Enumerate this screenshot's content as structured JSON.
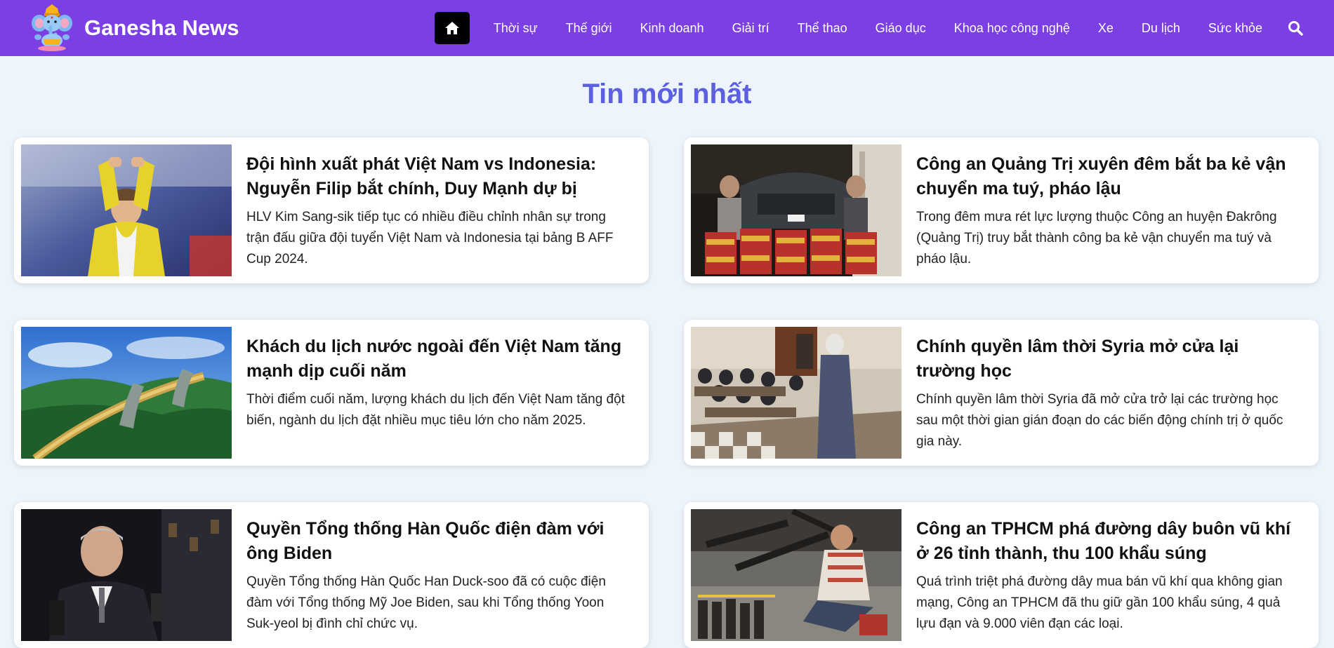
{
  "brand": {
    "name": "Ganesha News"
  },
  "nav": {
    "items": [
      "Thời sự",
      "Thế giới",
      "Kinh doanh",
      "Giải trí",
      "Thể thao",
      "Giáo dục",
      "Khoa học công nghệ",
      "Xe",
      "Du lịch",
      "Sức khỏe"
    ]
  },
  "section": {
    "title": "Tin mới nhất"
  },
  "articles": [
    {
      "title": "Đội hình xuất phát Việt Nam vs Indonesia: Nguyễn Filip bắt chính, Duy Mạnh dự bị",
      "description": "HLV Kim Sang-sik tiếp tục có nhiều điều chỉnh nhân sự trong trận đấu giữa đội tuyển Việt Nam và Indonesia tại bảng B AFF Cup 2024.",
      "image": "goalkeeper-applauding-photo"
    },
    {
      "title": "Công an Quảng Trị xuyên đêm bắt ba kẻ vận chuyển ma tuý, pháo lậu",
      "description": "Trong đêm mưa rét lực lượng thuộc Công an huyện Đakrông (Quảng Trị) truy bắt thành công ba kẻ vận chuyển ma tuý và pháo lậu.",
      "image": "seized-fireworks-car-photo"
    },
    {
      "title": "Khách du lịch nước ngoài đến Việt Nam tăng mạnh dịp cuối năm",
      "description": "Thời điểm cuối năm, lượng khách du lịch đến Việt Nam tăng đột biến, ngành du lịch đặt nhiều mục tiêu lớn cho năm 2025.",
      "image": "golden-bridge-photo"
    },
    {
      "title": "Chính quyền lâm thời Syria mở cửa lại trường học",
      "description": "Chính quyền lâm thời Syria đã mở cửa trở lại các trường học sau một thời gian gián đoạn do các biến động chính trị ở quốc gia này.",
      "image": "classroom-photo"
    },
    {
      "title": "Quyền Tổng thống Hàn Quốc điện đàm với ông Biden",
      "description": "Quyền Tổng thống Hàn Quốc Han Duck-soo đã có cuộc điện đàm với Tổng thống Mỹ Joe Biden, sau khi Tổng thống Yoon Suk-yeol bị đình chỉ chức vụ.",
      "image": "politician-interview-photo"
    },
    {
      "title": "Công an TPHCM phá đường dây buôn vũ khí ở 26 tỉnh thành, thu 100 khẩu súng",
      "description": "Quá trình triệt phá đường dây mua bán vũ khí qua không gian mạng, Công an TPHCM đã thu giữ gần 100 khẩu súng, 4 quả lựu đạn và 9.000 viên đạn các loại.",
      "image": "seized-weapons-photo"
    }
  ],
  "colors": {
    "navbar": "#7b3fe4",
    "page_background": "#eef4fc",
    "section_title": "#5b5fe0",
    "home_button": "#000000"
  },
  "icons": {
    "home": "home-icon",
    "search": "search-icon",
    "logo": "ganesha-logo"
  }
}
